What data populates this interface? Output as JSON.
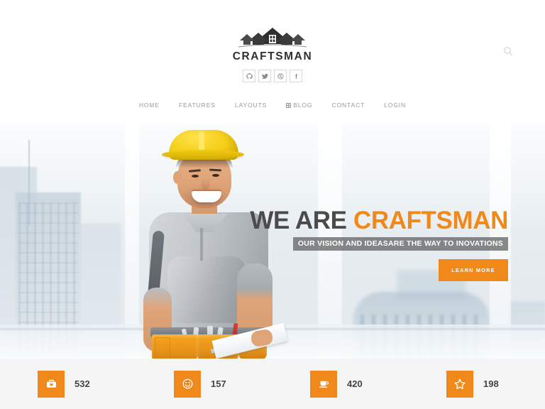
{
  "site": {
    "brand_name": "CRAFTSMAN",
    "logo_icon": "house-roofs-icon",
    "accent_color": "#F0891A",
    "dark_text_color": "#4B4B4B"
  },
  "header": {
    "search": {
      "icon": "search-icon",
      "label": "Search"
    },
    "social": [
      {
        "name": "github",
        "icon": "github-icon",
        "label": "GitHub"
      },
      {
        "name": "twitter",
        "icon": "twitter-icon",
        "label": "Twitter"
      },
      {
        "name": "dribbble",
        "icon": "dribbble-icon",
        "label": "Dribbble"
      },
      {
        "name": "facebook",
        "icon": "facebook-icon",
        "label": "Facebook"
      }
    ],
    "nav": [
      {
        "label": "HOME",
        "icon": null
      },
      {
        "label": "FEATURES",
        "icon": null
      },
      {
        "label": "LAYOUTS",
        "icon": null
      },
      {
        "label": "BLOG",
        "icon": "grid-badge-icon"
      },
      {
        "label": "CONTACT",
        "icon": null
      },
      {
        "label": "LOGIN",
        "icon": null
      }
    ]
  },
  "hero": {
    "title_plain": "WE ARE ",
    "title_accent": "CRAFTSMAN",
    "subtitle": "OUR VISION AND IDEASARE THE WAY TO INOVATIONS",
    "cta_label": "LEARN MORE",
    "image_alt": "Smiling construction worker in yellow hard hat holding a clipboard, blurred city skyline behind"
  },
  "counters": [
    {
      "icon": "briefcase-icon",
      "value": "532"
    },
    {
      "icon": "smiley-face-icon",
      "value": "157"
    },
    {
      "icon": "coffee-cup-icon",
      "value": "420"
    },
    {
      "icon": "star-icon",
      "value": "198"
    }
  ]
}
